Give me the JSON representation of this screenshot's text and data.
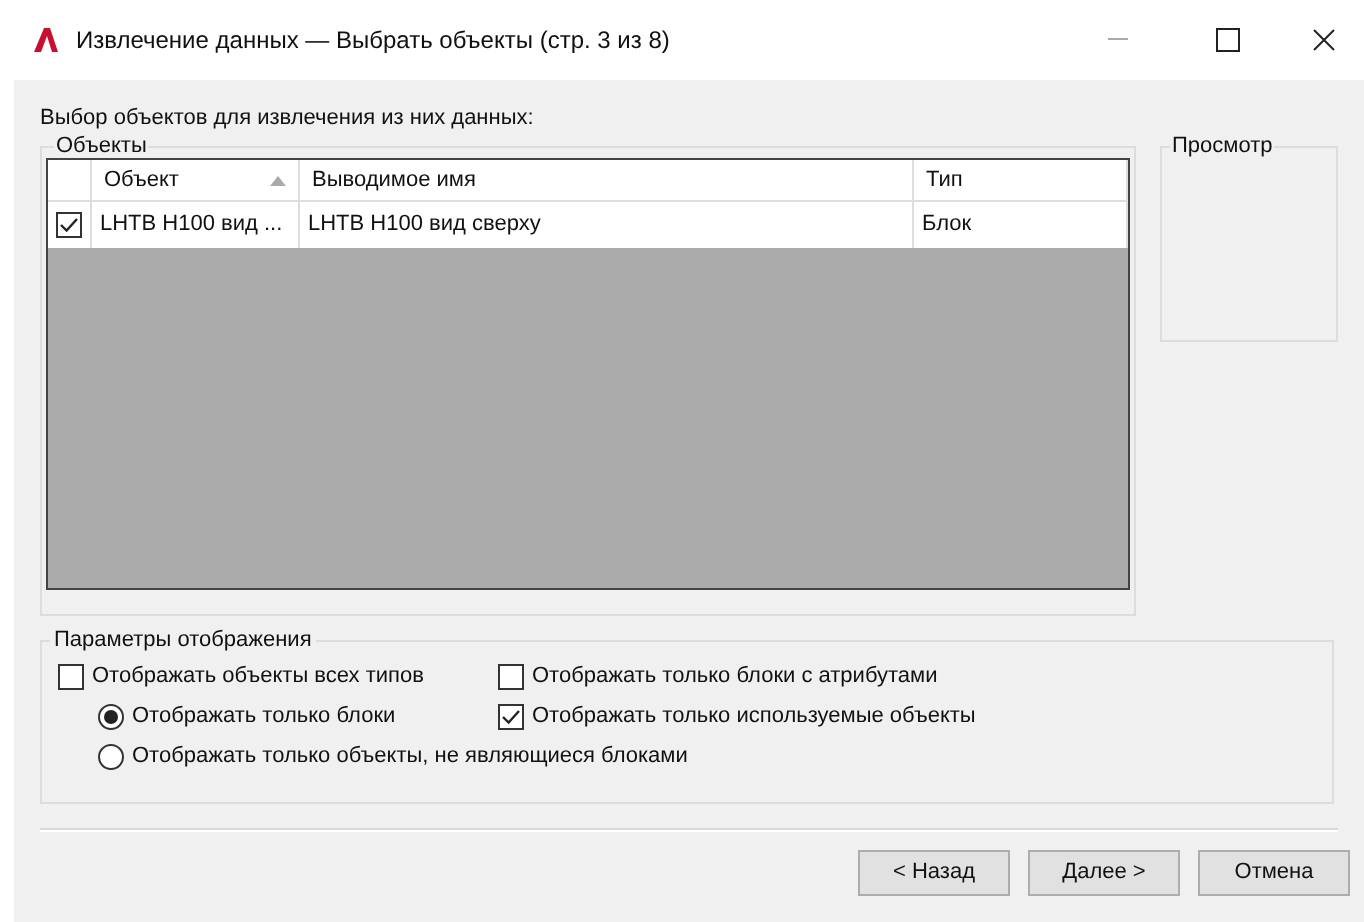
{
  "window": {
    "title": "Извлечение данных — Выбрать объекты (стр. 3 из 8)"
  },
  "instruction": "Выбор объектов для извлечения из них данных:",
  "objects_group": {
    "label": "Объекты",
    "columns": [
      {
        "label": "Объект",
        "sorted": true
      },
      {
        "label": "Выводимое имя",
        "sorted": false
      },
      {
        "label": "Тип",
        "sorted": false
      }
    ],
    "rows": [
      {
        "checked": true,
        "cells": [
          "LHTB H100 вид ...",
          "LHTB H100 вид сверху",
          "Блок"
        ]
      }
    ]
  },
  "preview_group": {
    "label": "Просмотр"
  },
  "display_options": {
    "label": "Параметры отображения",
    "options": [
      {
        "kind": "checkbox",
        "label": "Отображать объекты всех типов",
        "checked": false
      },
      {
        "kind": "checkbox",
        "label": "Отображать только блоки с атрибутами",
        "checked": false
      },
      {
        "kind": "radio",
        "label": "Отображать только блоки",
        "checked": true
      },
      {
        "kind": "checkbox",
        "label": "Отображать только используемые объекты",
        "checked": true
      },
      {
        "kind": "radio",
        "label": "Отображать только объекты, не являющиеся блоками",
        "checked": false
      }
    ]
  },
  "buttons": [
    "< Назад",
    "Далее >",
    "Отмена"
  ]
}
